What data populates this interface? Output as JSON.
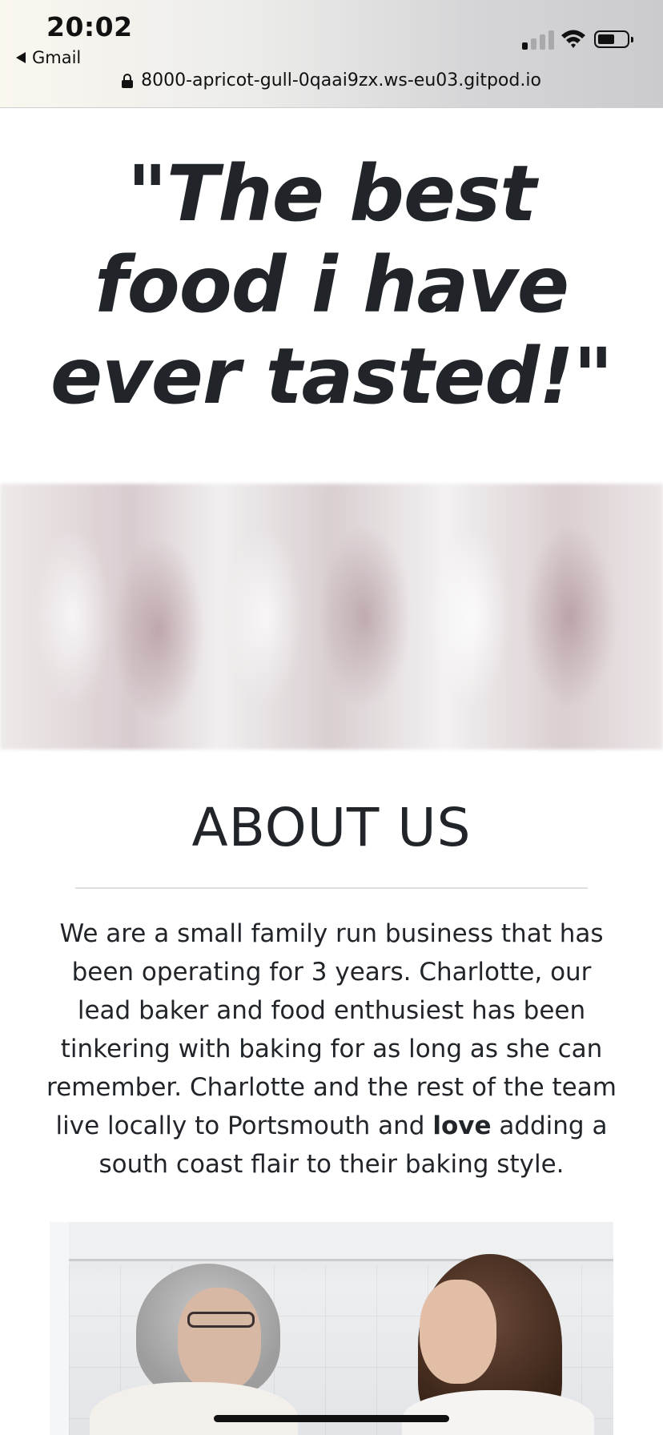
{
  "status_bar": {
    "time": "20:02",
    "back_app": "Gmail",
    "url": "8000-apricot-gull-0qaai9zx.ws-eu03.gitpod.io"
  },
  "main": {
    "quote": "\"The best food i have ever tasted!\"",
    "about": {
      "title": "ABOUT US",
      "text_before": "We are a small family run business that has been operating for 3 years. Charlotte, our lead baker and food enthusiest has been tinkering with baking for as long as she can remember. Charlotte and the rest of the team live locally to Portsmouth and ",
      "text_bold": "love",
      "text_after": " adding a south coast flair to their baking style."
    }
  },
  "icons": {
    "back": "back-arrow-icon",
    "signal": "cellular-signal-icon",
    "wifi": "wifi-icon",
    "battery": "battery-icon",
    "lock": "lock-icon"
  },
  "colors": {
    "text": "#212529",
    "divider": "#dedede"
  }
}
